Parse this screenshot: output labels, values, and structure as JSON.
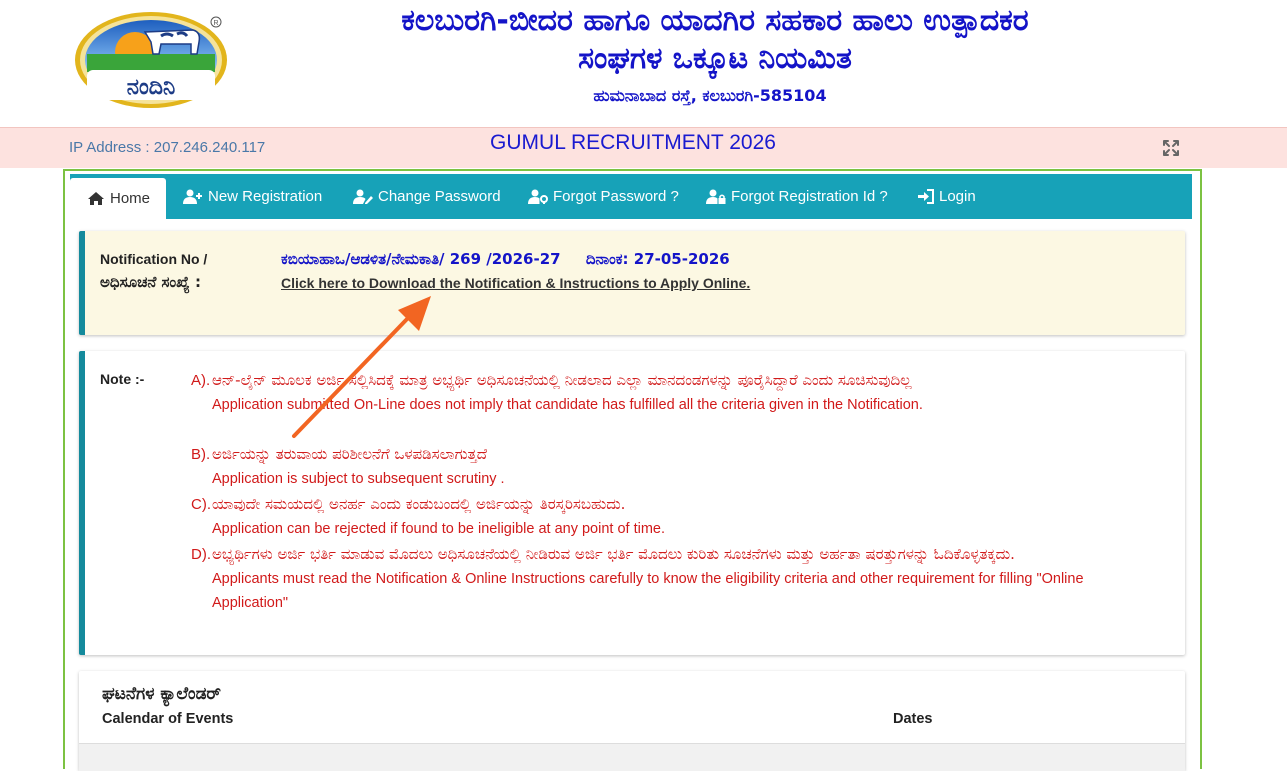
{
  "header": {
    "logo_text": "ನಂದಿನಿ",
    "org_line1": "ಕಲಬುರಗಿ-ಬೀದರ ಹಾಗೂ ಯಾದಗಿರ ಸಹಕಾರ ಹಾಲು ಉತ್ಪಾದಕರ",
    "org_line2": "ಸಂಘಗಳ ಒಕ್ಕೂಟ ನಿಯಮಿತ",
    "address": "ಹುಮನಾಬಾದ ರಸ್ತೆ, ಕಲಬುರಗಿ-585104"
  },
  "strip": {
    "ip_address": "IP Address : 207.246.240.117",
    "recruitment_title": "GUMUL RECRUITMENT 2026"
  },
  "nav": {
    "items": [
      {
        "label": "Home",
        "icon": "home-icon"
      },
      {
        "label": "New Registration",
        "icon": "user-plus-icon"
      },
      {
        "label": "Change Password",
        "icon": "user-edit-icon"
      },
      {
        "label": "Forgot Password ?",
        "icon": "user-key-icon"
      },
      {
        "label": "Forgot Registration Id ?",
        "icon": "user-lock-icon"
      },
      {
        "label": "Login",
        "icon": "sign-in-icon"
      }
    ]
  },
  "notification": {
    "label_en": "Notification No /",
    "label_kn": "ಅಧಿಸೂಚನೆ ಸಂಖ್ಯೆ :",
    "number": "ಕಬಿಯಾಹಾಒ/ಆಡಳಿತ/ನೇಮಕಾತಿ/ 269 /2026-27",
    "date": "ದಿನಾಂಕ: 27-05-2026",
    "link_text": "Click here to Download the Notification & Instructions to Apply Online."
  },
  "note": {
    "label": "Note :-",
    "items": [
      {
        "letter": "A).",
        "kn": "ಆನ್-ಲೈನ್ ಮೂಲಕ ಅರ್ಜಿ ಸಲ್ಲಿಸಿದಕ್ಕೆ ಮಾತ್ರ ಅಭ್ಯರ್ಥಿ ಅಧಿಸೂಚನೆಯಲ್ಲಿ ನೀಡಲಾದ ಎಲ್ಲಾ ಮಾನದಂಡಗಳನ್ನು ಪೂರೈಸಿದ್ದಾರೆ ಎಂದು ಸೂಚಿಸುವುದಿಲ್ಲ",
        "en": "Application submitted On-Line does not imply that candidate has fulfilled all the criteria given in the Notification."
      },
      {
        "letter": "B).",
        "kn": "ಅರ್ಜಿಯನ್ನು ತರುವಾಯ ಪರಿಶೀಲನೆಗೆ ಒಳಪಡಿಸಲಾಗುತ್ತದೆ",
        "en": "Application is subject to subsequent scrutiny ."
      },
      {
        "letter": "C).",
        "kn": "ಯಾವುದೇ ಸಮಯದಲ್ಲಿ ಅನರ್ಹ ಎಂದು ಕಂಡುಬಂದಲ್ಲಿ ಅರ್ಜಿಯನ್ನು ತಿರಸ್ಕರಿಸಬಹುದು.",
        "en": "Application can be rejected if found to be ineligible at any point of time."
      },
      {
        "letter": "D).",
        "kn": "ಅಭ್ಯರ್ಥಿಗಳು ಅರ್ಜಿ ಭರ್ತಿ ಮಾಡುವ ಮೊದಲು ಅಧಿಸೂಚನೆಯಲ್ಲಿ ನೀಡಿರುವ ಅರ್ಜಿ ಭರ್ತಿ ಮೊದಲು ಕುರಿತು ಸೂಚನೆಗಳು ಮತ್ತು ಅರ್ಹತಾ ಷರತ್ತುಗಳನ್ನು ಓದಿಕೊಳ್ಳತಕ್ಕದು.",
        "en": "Applicants must read the Notification & Online Instructions carefully to know the eligibility criteria and other requirement for filling \"Online Application\""
      }
    ]
  },
  "calendar": {
    "title_kn": "ಘಟನೆಗಳ ಕ್ಯಾಲೆಂಡರ್",
    "title_en": "Calendar of Events",
    "dates_header": "Dates"
  },
  "colors": {
    "nav_bg": "#17a2b8",
    "accent_border": "#148a9c",
    "org_title": "#1414c8",
    "note_text": "#d11a1a",
    "strip_bg": "#fde2df",
    "frame_green": "#7cc242",
    "arrow": "#f26522"
  }
}
